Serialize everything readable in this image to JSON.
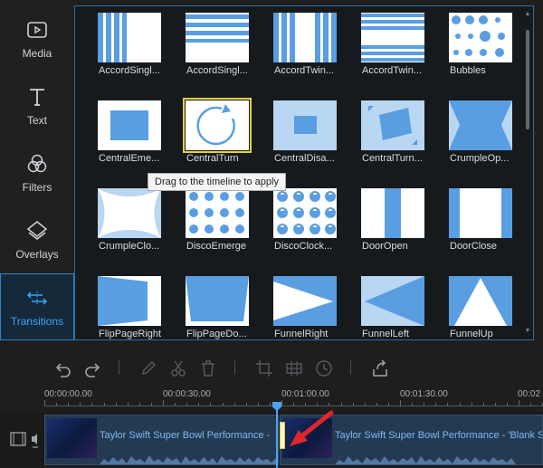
{
  "sidebar": {
    "items": [
      {
        "label": "Media",
        "icon": "media-icon"
      },
      {
        "label": "Text",
        "icon": "text-icon"
      },
      {
        "label": "Filters",
        "icon": "filters-icon"
      },
      {
        "label": "Overlays",
        "icon": "overlays-icon"
      },
      {
        "label": "Transitions",
        "icon": "transitions-icon",
        "active": true
      }
    ]
  },
  "transitions": {
    "items": [
      {
        "label": "AccordSingl..."
      },
      {
        "label": "AccordSingl..."
      },
      {
        "label": "AccordTwin..."
      },
      {
        "label": "AccordTwin..."
      },
      {
        "label": "Bubbles"
      },
      {
        "label": "CentralEme..."
      },
      {
        "label": "CentralTurn",
        "selected": true
      },
      {
        "label": "CentralDisa..."
      },
      {
        "label": "CentralTurn..."
      },
      {
        "label": "CrumpleOp..."
      },
      {
        "label": "CrumpleClo..."
      },
      {
        "label": "DiscoEmerge"
      },
      {
        "label": "DiscoClock..."
      },
      {
        "label": "DoorOpen"
      },
      {
        "label": "DoorClose"
      },
      {
        "label": "FlipPageRight"
      },
      {
        "label": "FlipPageDo..."
      },
      {
        "label": "FunnelRight"
      },
      {
        "label": "FunnelLeft"
      },
      {
        "label": "FunnelUp"
      }
    ]
  },
  "tooltip": {
    "text": "Drag to the timeline to apply"
  },
  "toolbar": {
    "tools": [
      "undo-icon",
      "redo-icon",
      "edit-icon",
      "cut-icon",
      "delete-icon",
      "crop-icon",
      "mosaic-icon",
      "speed-icon",
      "export-icon"
    ]
  },
  "timeline": {
    "ticks": [
      "00:00:00.00",
      "00:00:30.00",
      "00:01:00.00",
      "00:01:30.00",
      "00:02"
    ],
    "clips": [
      {
        "title": "Taylor Swift Super Bowl Performance - "
      },
      {
        "title": "Taylor Swift Super Bowl Performance - 'Blank S"
      }
    ]
  },
  "colors": {
    "accent": "#3aa2ff",
    "thumb_blue": "#5a9ee2",
    "thumb_light": "#b9d6f2",
    "selected_border": "#e2d341"
  }
}
